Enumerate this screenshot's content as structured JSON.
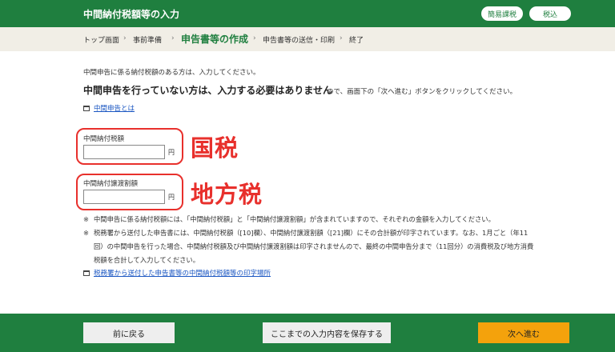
{
  "header": {
    "title": "中間納付税額等の入力",
    "simple_label": "簡易課税",
    "tax_label": "税込"
  },
  "breadcrumb": {
    "items": [
      "トップ画面",
      "事前準備",
      "申告書等の作成",
      "申告書等の送信・印刷",
      "終了"
    ],
    "separator": "›",
    "active_index": 2
  },
  "intro": {
    "line1": "中間申告に係る納付税額のある方は、入力してください。",
    "lead_bold": "中間申告を行っていない方は、入力する必要はありません",
    "lead_rest": "ので、画面下の「次へ進む」ボタンをクリックしてください。",
    "link": "中間申告とは"
  },
  "national": {
    "label": "中間納付税額",
    "value": "",
    "unit": "円",
    "annotation": "国税"
  },
  "local": {
    "label": "中間納付譲渡割額",
    "value": "",
    "unit": "円",
    "annotation": "地方税"
  },
  "notes": {
    "mark": "※",
    "n1": "中間申告に係る納付税額には、「中間納付税額」と「中間納付譲渡割額」が含まれていますので、それぞれの金額を入力してください。",
    "n2_l1": "税務署から送付した申告書には、中間納付税額（[10]欄）、中間納付譲渡割額（[21]欄）にその合計額が印字されています。なお、1月ごと（年11",
    "n2_l2": "回）の中間申告を行った場合、中間納付税額及び中間納付譲渡割額は印字されませんので、最終の中間申告分まで（11回分）の消費税及び地方消費",
    "n2_l3": "税額を合計して入力してください。",
    "link": "税務署から送付した申告書等の中間納付税額等の印字場所"
  },
  "footer": {
    "back": "前に戻る",
    "save": "ここまでの入力内容を保存する",
    "next": "次へ進む"
  },
  "colors": {
    "brand_green": "#1f7f3f",
    "accent_orange": "#f4a20c",
    "annotation_red": "#e8302c",
    "link_blue": "#1a56c2"
  }
}
